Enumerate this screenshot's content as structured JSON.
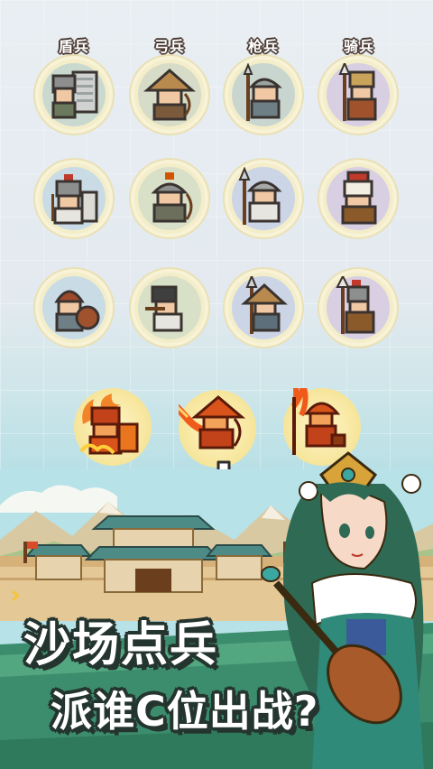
{
  "columns": {
    "shield": "盾兵",
    "archer": "弓兵",
    "spear": "枪兵",
    "cavalry": "骑兵"
  },
  "units": {
    "row1": [
      "shield-soldier",
      "archer-soldier",
      "spear-soldier",
      "cavalry-soldier"
    ],
    "row2": [
      "shield-soldier",
      "archer-soldier",
      "spear-soldier",
      "cavalry-soldier"
    ],
    "row3": [
      "shield-soldier",
      "archer-soldier",
      "spear-soldier",
      "cavalry-soldier"
    ],
    "fire_row": [
      "fire-shield-soldier",
      "fire-archer-soldier",
      "fire-spear-soldier"
    ]
  },
  "banner": {
    "line1": "沙场点兵",
    "line2": "派谁C位出战?"
  },
  "side_arrow": "›",
  "colors": {
    "label_outline": "#4a3a33",
    "circle_fill": "#f3edc9",
    "title_outline": "#24342e",
    "arrow": "#f5c633"
  }
}
